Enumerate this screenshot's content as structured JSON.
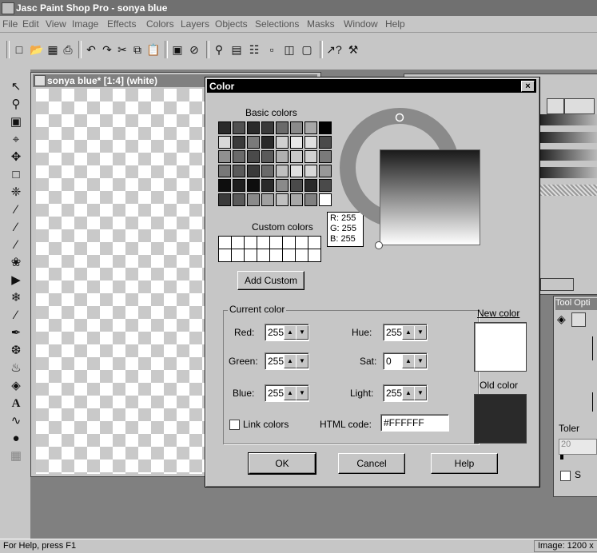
{
  "app": {
    "title": "Jasc Paint Shop Pro - sonya blue",
    "menu": [
      "File",
      "Edit",
      "View",
      "Image",
      "Effects",
      "Colors",
      "Layers",
      "Objects",
      "Selections",
      "Masks",
      "Window",
      "Help"
    ]
  },
  "toolbar": {
    "icons": [
      "new-icon",
      "open-icon",
      "save-icon",
      "print-icon",
      "undo-icon",
      "redo-icon",
      "cut-icon",
      "copy-icon",
      "paste-icon",
      "browse-icon",
      "full-screen-icon",
      "zoom-icon",
      "color-palette-icon",
      "layers-icon",
      "histogram-icon",
      "overview-icon",
      "tool-options-icon",
      "context-help-icon",
      "toolbox-icon"
    ]
  },
  "image_window": {
    "title": "sonya blue* [1:4] (white)"
  },
  "tool_options": {
    "title": "Tool Opti",
    "tolerance_label": "Toler",
    "tolerance_value": "20",
    "sample_label": "S"
  },
  "status": {
    "help": "For Help, press F1",
    "image_info": "Image: 1200 x"
  },
  "dialog": {
    "title": "Color",
    "close_label": "×",
    "basic_colors_label": "Basic colors",
    "custom_colors_label": "Custom colors",
    "add_custom_label": "Add Custom",
    "tooltip": {
      "r": "R: 255",
      "g": "G: 255",
      "b": "B: 255"
    },
    "current_color_label": "Current color",
    "fields": {
      "red": {
        "label": "Red:",
        "value": "255"
      },
      "green": {
        "label": "Green:",
        "value": "255"
      },
      "blue": {
        "label": "Blue:",
        "value": "255"
      },
      "hue": {
        "label": "Hue:",
        "value": "255"
      },
      "sat": {
        "label": "Sat:",
        "value": "0"
      },
      "light": {
        "label": "Light:",
        "value": "255"
      }
    },
    "link_colors_label": "Link colors",
    "html_code_label": "HTML code:",
    "html_code_value": "#FFFFFF",
    "new_color_label": "New color",
    "old_color_label": "Old color",
    "new_color": "#FFFFFF",
    "old_color": "#2A2A2A",
    "ok_label": "OK",
    "cancel_label": "Cancel",
    "help_label": "Help",
    "basic_swatches": [
      "#2a2a2a",
      "#505050",
      "#2a2a2a",
      "#3a3a3a",
      "#6a6a6a",
      "#8a8a8a",
      "#a8a8a8",
      "#000000",
      "#d8d8d8",
      "#3a3a3a",
      "#7a7a7a",
      "#2a2a2a",
      "#d0d0d0",
      "#e8e8e8",
      "#e0e0e0",
      "#4a4a4a",
      "#909090",
      "#6a6a6a",
      "#4a4a4a",
      "#5a5a5a",
      "#b0b0b0",
      "#c8c8c8",
      "#d0d0d0",
      "#7a7a7a",
      "#787878",
      "#5a5a5a",
      "#3a3a3a",
      "#6a6a6a",
      "#c0c0c0",
      "#e0e0e0",
      "#d8d8d8",
      "#989898",
      "#0e0e0e",
      "#1e1e1e",
      "#0e0e0e",
      "#2a2a2a",
      "#8a8a8a",
      "#4a4a4a",
      "#2a2a2a",
      "#4a4a4a",
      "#3a3a3a",
      "#5a5a5a",
      "#8a8a8a",
      "#a0a0a0",
      "#c0c0c0",
      "#a8a8a8",
      "#808080",
      "#ffffff"
    ]
  }
}
